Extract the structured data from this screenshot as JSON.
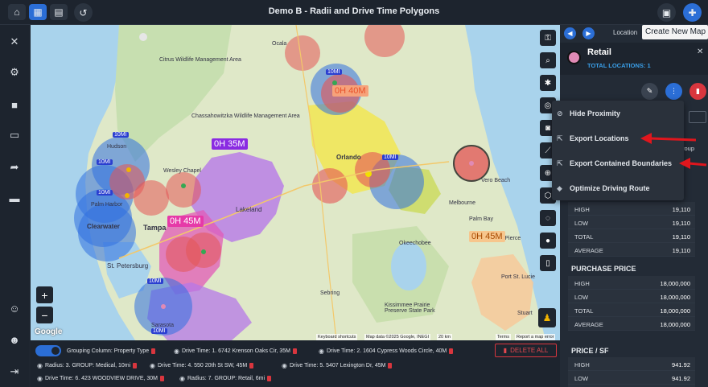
{
  "window": {
    "title": "Demo B - Radii and Drive Time Polygons",
    "tooltip": "Create New Map"
  },
  "topbar": {
    "left_icons": [
      "home-icon",
      "map-icon",
      "table-icon",
      "undo-icon"
    ],
    "right_icons": [
      "image-icon",
      "new-map-icon"
    ]
  },
  "leftbar": {
    "icons": [
      "tools-icon",
      "gear-icon",
      "save-icon",
      "presentation-icon",
      "share-icon",
      "window-icon",
      "add-user-icon",
      "support-icon",
      "logout-icon"
    ]
  },
  "map": {
    "labels": [
      "Citrus Wildlife Management Area",
      "Chassahowitzka Wildlife Management Area",
      "Hudson",
      "Wesley Chapel",
      "Palm Harbor",
      "Clearwater",
      "Tampa",
      "St. Petersburg",
      "Lakeland",
      "Sebring",
      "Melbourne",
      "Fort Pierce",
      "Okeechobee",
      "Kissimmee Prairie Preserve State Park",
      "Port St. Lucie",
      "Stuart",
      "Ocala",
      "Orlando",
      "Palm Bay",
      "Vero Beach",
      "Sarasota"
    ],
    "drive_time_labels": [
      {
        "text": "0H 40M",
        "color": "#e8512b",
        "bg": "#f6a27a"
      },
      {
        "text": "0H 35M",
        "color": "#ffffff",
        "bg": "#8a2be2"
      },
      {
        "text": "0H 45M",
        "color": "#ffffff",
        "bg": "#e63aa8"
      },
      {
        "text": "0H 45M",
        "color": "#a84a00",
        "bg": "#f7c68d"
      }
    ],
    "radius_labels": [
      "10MI",
      "10MI",
      "10MI",
      "10MI",
      "10MI",
      "10MI",
      "10MI"
    ],
    "google": "Google",
    "attribution": [
      "Keyboard shortcuts",
      "Map data ©2025 Google, INEGI",
      "20 km",
      "Terms",
      "Report a map error"
    ],
    "controls": [
      "key-icon",
      "search-icon",
      "bug-icon",
      "locate-icon",
      "camera-icon",
      "ruler-icon",
      "magnify-icon",
      "polygon-icon",
      "lasso-icon",
      "pin-icon",
      "document-icon"
    ],
    "zoom_in": "+",
    "zoom_out": "−"
  },
  "filterbar": {
    "chips": [
      "Grouping Column: Property Type",
      "Drive Time: 1. 6742 Krenson Oaks Cir, 35M",
      "Drive Time: 2. 1604 Cypress Woods Circle, 40M",
      "Radius: 3. GROUP: Medical, 10mi",
      "Drive Time: 4. 550 20th St SW, 45M",
      "Drive Time: 5. 5407 Lexington Dr, 45M",
      "Drive Time: 6. 423 WOODVIEW DRIVE, 30M",
      "Radius: 7. GROUP: Retail, 6mi"
    ],
    "delete_all": "DELETE ALL"
  },
  "panel": {
    "header_label": "Location",
    "title": "Retail",
    "subtitle": "TOTAL LOCATIONS: 1",
    "dot_color": "#e08ab5",
    "stats_top": [
      {
        "k": "HIGH",
        "v": "19,110"
      },
      {
        "k": "LOW",
        "v": "19,110"
      },
      {
        "k": "TOTAL",
        "v": "19,110"
      },
      {
        "k": "AVERAGE",
        "v": "19,110"
      }
    ],
    "purchase_title": "PURCHASE PRICE",
    "purchase": [
      {
        "k": "HIGH",
        "v": "18,000,000"
      },
      {
        "k": "LOW",
        "v": "18,000,000"
      },
      {
        "k": "TOTAL",
        "v": "18,000,000"
      },
      {
        "k": "AVERAGE",
        "v": "18,000,000"
      }
    ],
    "price_sf_title": "PRICE / SF",
    "price_sf": [
      {
        "k": "HIGH",
        "v": "941.92"
      },
      {
        "k": "LOW",
        "v": "941.92"
      }
    ],
    "partial_text": "roup"
  },
  "menu": {
    "items": [
      {
        "label": "Hide Proximity",
        "icon": "eye-off-icon"
      },
      {
        "label": "Export Locations",
        "icon": "export-icon"
      },
      {
        "label": "Export Contained Boundaries",
        "icon": "export-icon"
      },
      {
        "label": "Optimize Driving Route",
        "icon": "route-icon"
      }
    ]
  },
  "colors": {
    "accent": "#2b6ed6",
    "danger": "#d9363e",
    "arrow": "#e0161d"
  }
}
